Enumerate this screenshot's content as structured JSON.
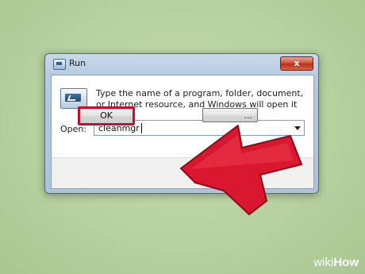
{
  "window": {
    "title": "Run",
    "close_label": "x"
  },
  "dialog": {
    "description": "Type the name of a program, folder, document, or Internet resource, and Windows will open it for you.",
    "open_label": "Open:",
    "open_value": "cleanmgr",
    "ok_label": "OK",
    "cancel_label": "..."
  },
  "overlay": {
    "arrow_color": "#d9172e",
    "highlight_color": "#c8102e"
  },
  "watermark": {
    "brand_prefix": "wiki",
    "brand_suffix": "How"
  }
}
